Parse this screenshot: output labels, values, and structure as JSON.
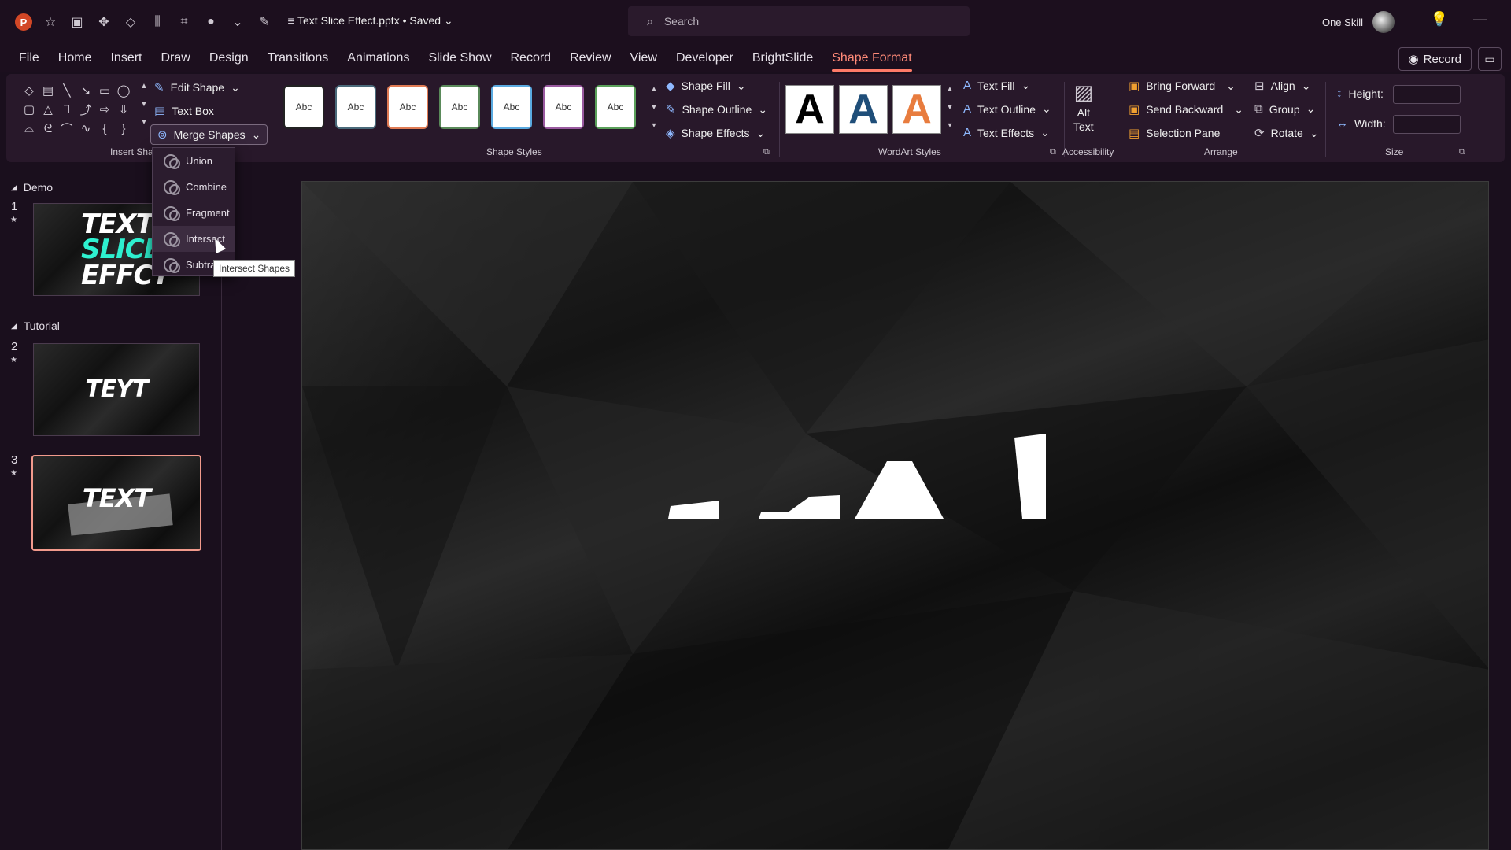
{
  "titlebar": {
    "app_logo": "P",
    "doc_title": "Text Slice Effect.pptx • Saved",
    "search_placeholder": "Search",
    "account_name": "One Skill"
  },
  "tabs": [
    "File",
    "Home",
    "Insert",
    "Draw",
    "Design",
    "Transitions",
    "Animations",
    "Slide Show",
    "Record",
    "Review",
    "View",
    "Developer",
    "BrightSlide",
    "Shape Format"
  ],
  "active_tab": "Shape Format",
  "record_label": "Record",
  "ribbon": {
    "insert_shapes": {
      "label": "Insert Sha",
      "edit_shape": "Edit Shape",
      "text_box": "Text Box",
      "merge_shapes": "Merge Shapes"
    },
    "shape_styles": {
      "label": "Shape Styles",
      "abc": [
        "Abc",
        "Abc",
        "Abc",
        "Abc",
        "Abc",
        "Abc",
        "Abc"
      ],
      "fill": "Shape Fill",
      "outline": "Shape Outline",
      "effects": "Shape Effects"
    },
    "wordart": {
      "label": "WordArt Styles",
      "letters": [
        "A",
        "A",
        "A"
      ],
      "text_fill": "Text Fill",
      "text_outline": "Text Outline",
      "text_effects": "Text Effects"
    },
    "accessibility": {
      "label": "Accessibility",
      "alt": "Alt",
      "text": "Text"
    },
    "arrange": {
      "label": "Arrange",
      "bring_forward": "Bring Forward",
      "send_backward": "Send Backward",
      "selection_pane": "Selection Pane",
      "align": "Align",
      "group": "Group",
      "rotate": "Rotate"
    },
    "size": {
      "label": "Size",
      "height": "Height:",
      "width": "Width:"
    }
  },
  "merge_menu": {
    "items": [
      "Union",
      "Combine",
      "Fragment",
      "Intersect",
      "Subtra"
    ],
    "tooltip": "Intersect Shapes"
  },
  "slides": {
    "sections": [
      "Demo",
      "Tutorial"
    ],
    "numbers": [
      "1",
      "2",
      "3"
    ],
    "thumb1": [
      "TEXT",
      "SLICE",
      "EFFCT"
    ],
    "thumb2": "TEYT",
    "thumb3": "TEXT"
  },
  "colors": {
    "accent": "#ff7b68",
    "cyan": "#2ef0cf",
    "abc_borders": [
      "#222222",
      "#4a6a7a",
      "#e07b54",
      "#5a8a5a",
      "#5aaae0",
      "#9a5aa0",
      "#5aa05a"
    ],
    "wordart": [
      "#000000",
      "#1f4e79",
      "#e87c3e"
    ]
  }
}
